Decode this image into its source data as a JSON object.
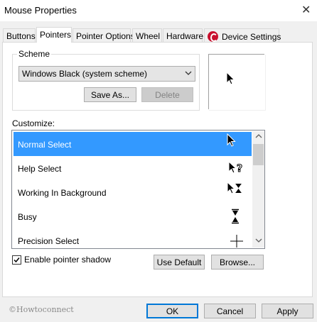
{
  "window": {
    "title": "Mouse Properties",
    "close_glyph": "✕"
  },
  "tabs": [
    {
      "label": "Buttons"
    },
    {
      "label": "Pointers"
    },
    {
      "label": "Pointer Options"
    },
    {
      "label": "Wheel"
    },
    {
      "label": "Hardware"
    },
    {
      "label": "Device Settings"
    }
  ],
  "scheme": {
    "legend": "Scheme",
    "selected": "Windows Black (system scheme)",
    "save_as_label": "Save As...",
    "delete_label": "Delete"
  },
  "customize": {
    "label": "Customize:",
    "items": [
      {
        "label": "Normal Select",
        "icon": "arrow-cursor-icon",
        "selected": true
      },
      {
        "label": "Help Select",
        "icon": "help-cursor-icon",
        "selected": false
      },
      {
        "label": "Working In Background",
        "icon": "working-cursor-icon",
        "selected": false
      },
      {
        "label": "Busy",
        "icon": "hourglass-icon",
        "selected": false
      },
      {
        "label": "Precision Select",
        "icon": "crosshair-icon",
        "selected": false
      }
    ]
  },
  "shadow": {
    "label": "Enable pointer shadow",
    "checked": true
  },
  "buttons": {
    "use_default": "Use Default",
    "browse": "Browse...",
    "ok": "OK",
    "cancel": "Cancel",
    "apply": "Apply"
  },
  "watermark": "©Howtoconnect",
  "colors": {
    "selection": "#3399ff",
    "accent": "#0078d7",
    "device_icon": "#c8102e"
  }
}
